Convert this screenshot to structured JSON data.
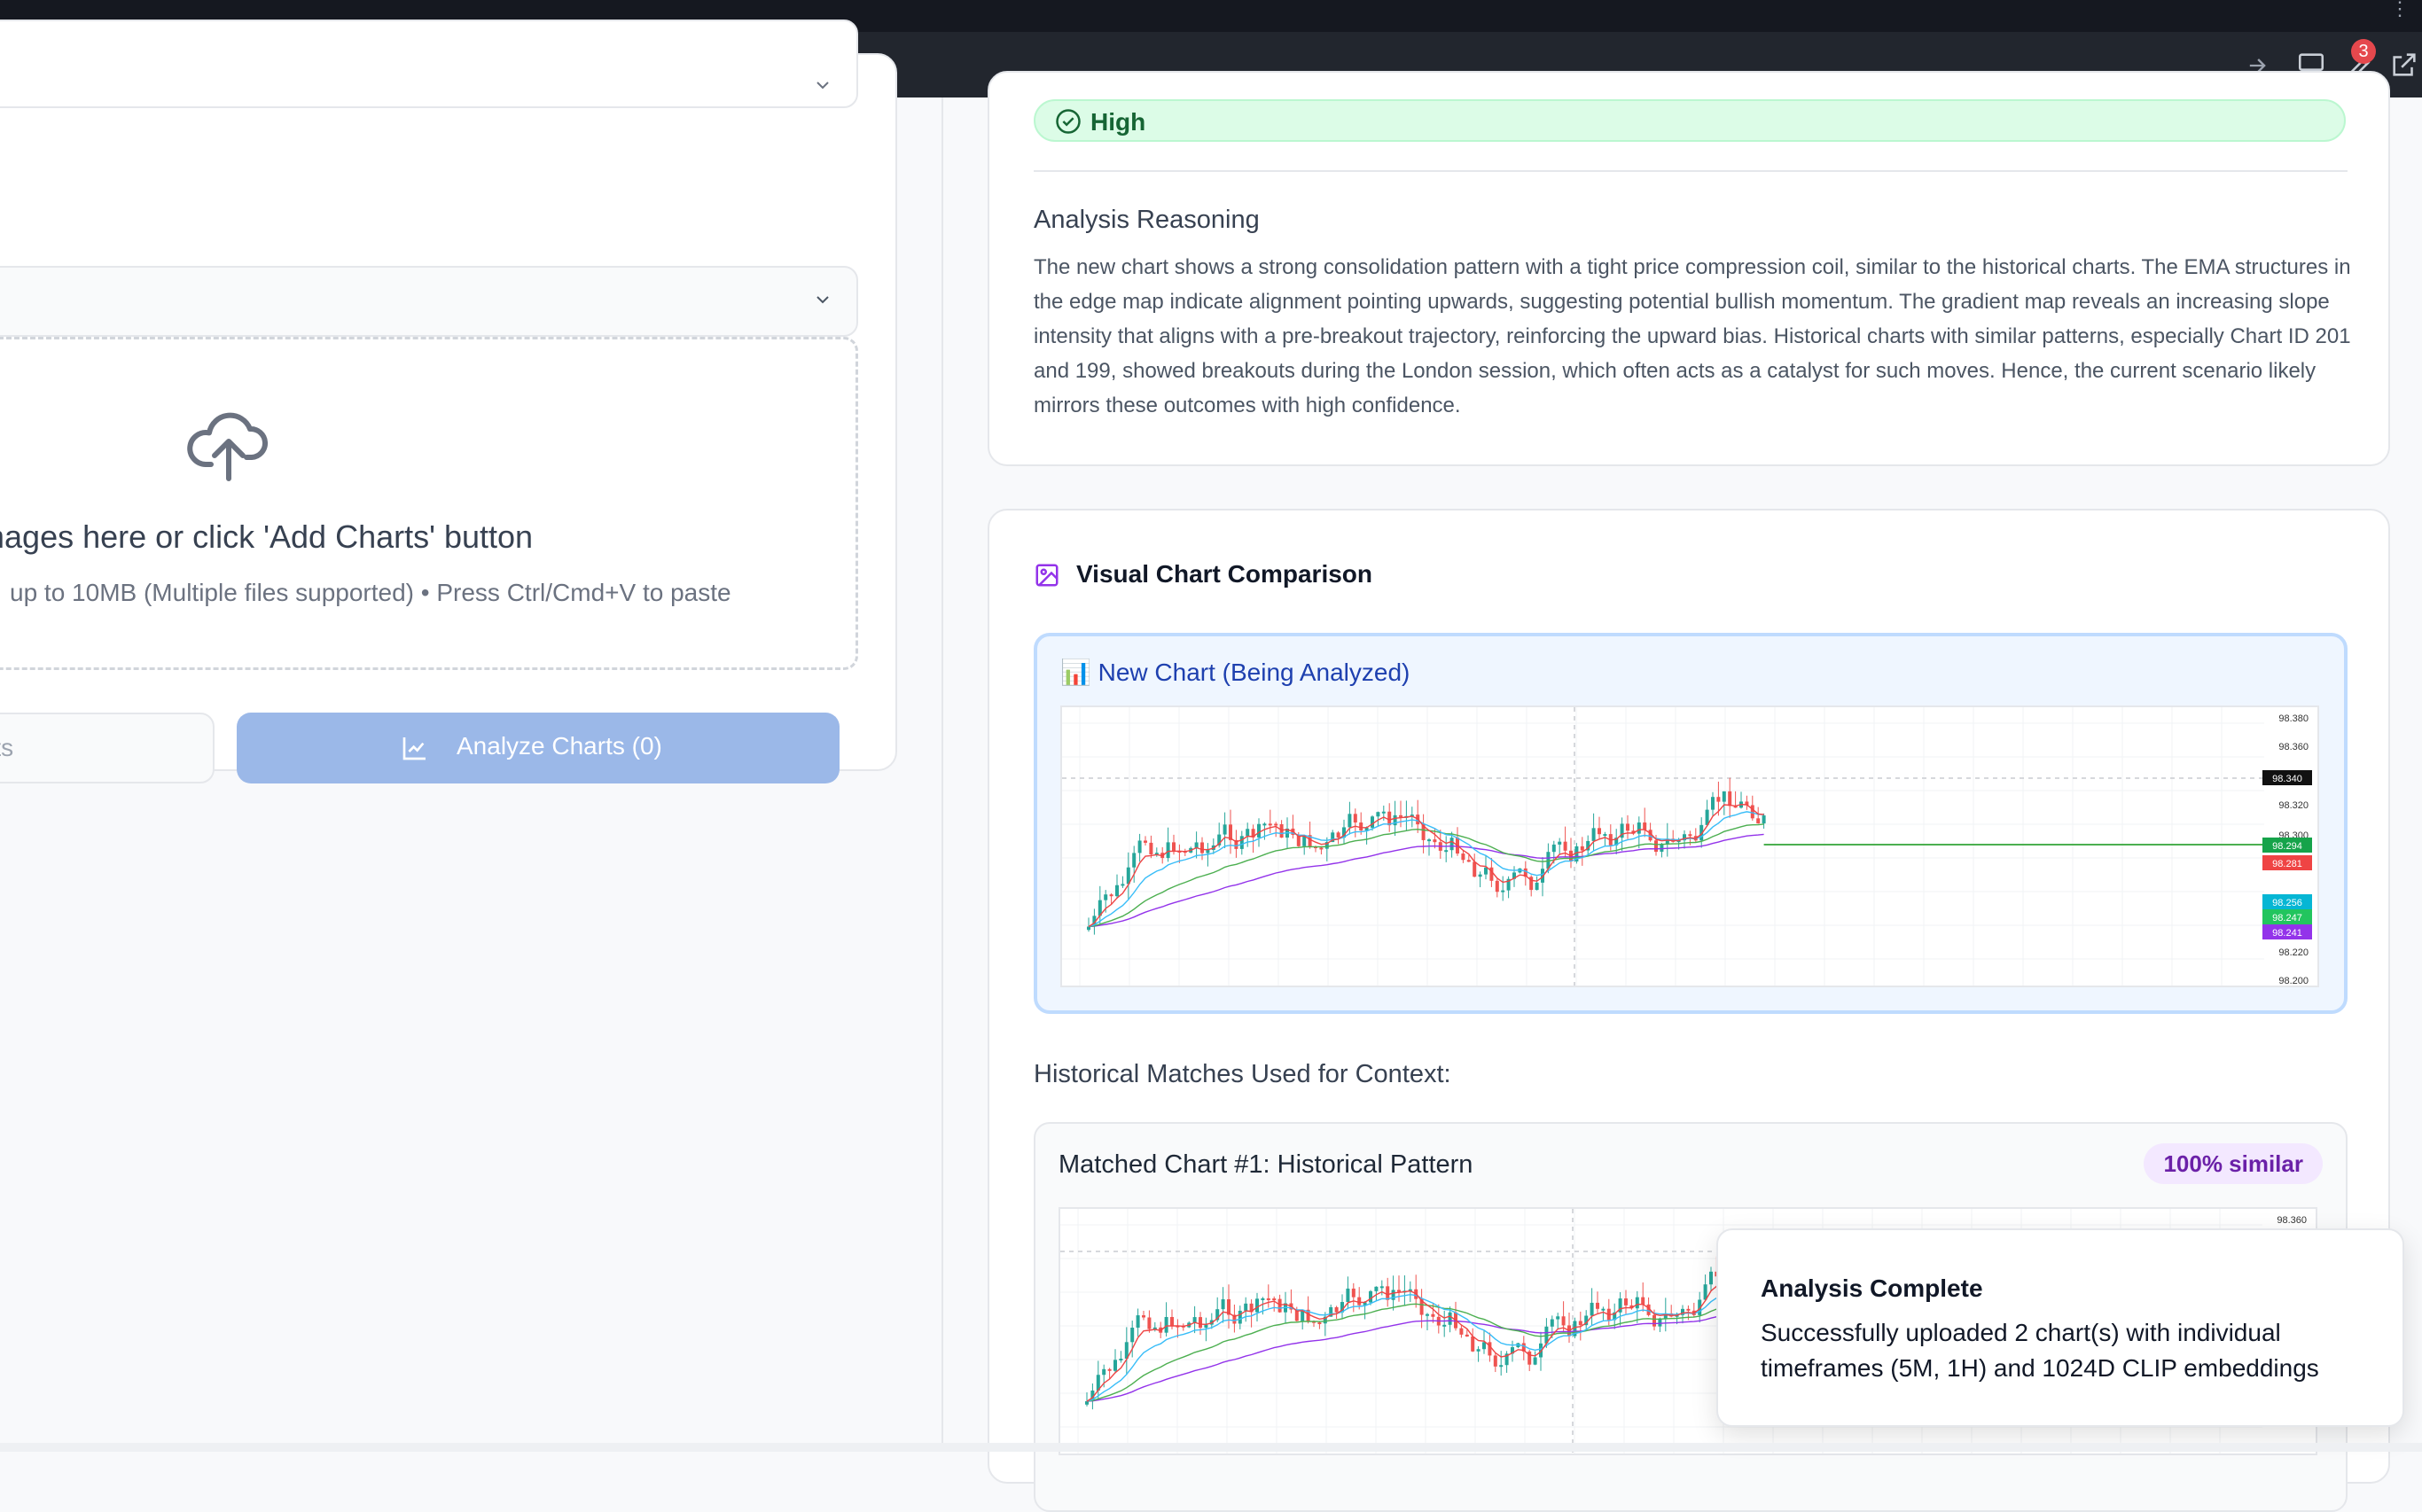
{
  "toolbar": {
    "notification_count": "3",
    "icons": [
      "arrow-right-icon",
      "monitor-icon",
      "wrench-icon",
      "external-link-icon"
    ]
  },
  "left": {
    "dropzone_title": "hart images here or click 'Add Charts' button",
    "dropzone_sub": "up to 10MB (Multiple files supported) • Press Ctrl/Cmd+V to paste",
    "add_button_partial": "rts",
    "analyze_button": "Analyze Charts (0)"
  },
  "analysis": {
    "confidence": "High",
    "reasoning_heading": "Analysis Reasoning",
    "reasoning_text": "The new chart shows a strong consolidation pattern with a tight price compression coil, similar to the historical charts. The EMA structures in the edge map indicate alignment pointing upwards, suggesting potential bullish momentum. The gradient map reveals an increasing slope intensity that aligns with a pre-breakout trajectory, reinforcing the upward bias. Historical charts with similar patterns, especially Chart ID 201 and 199, showed breakouts during the London session, which often acts as a catalyst for such moves. Hence, the current scenario likely mirrors these outcomes with high confidence."
  },
  "visual": {
    "heading": "Visual Chart Comparison",
    "new_chart_title": "📊 New Chart (Being Analyzed)",
    "historical_heading": "Historical Matches Used for Context:",
    "match_title": "Matched Chart #1: Historical Pattern",
    "match_similarity": "100% similar"
  },
  "chart_data": {
    "type": "line",
    "price_axis_ticks": [
      "98.380",
      "98.360",
      "98.340",
      "98.320",
      "98.300",
      "98.294",
      "98.281",
      "98.256",
      "98.247",
      "98.241",
      "98.220",
      "98.200"
    ],
    "price_labels": [
      {
        "value": "98.340",
        "color": "#111111"
      },
      {
        "value": "98.294",
        "color": "#16a34a"
      },
      {
        "value": "98.281",
        "color": "#ef4444"
      },
      {
        "value": "98.256",
        "color": "#06b6d4"
      },
      {
        "value": "98.247",
        "color": "#22c55e"
      },
      {
        "value": "98.241",
        "color": "#9333ea"
      }
    ],
    "match_axis_ticks": [
      "98.360"
    ]
  },
  "toast": {
    "title": "Analysis Complete",
    "message": "Successfully uploaded 2 chart(s) with individual timeframes (5M, 1H) and 1024D CLIP embeddings"
  }
}
